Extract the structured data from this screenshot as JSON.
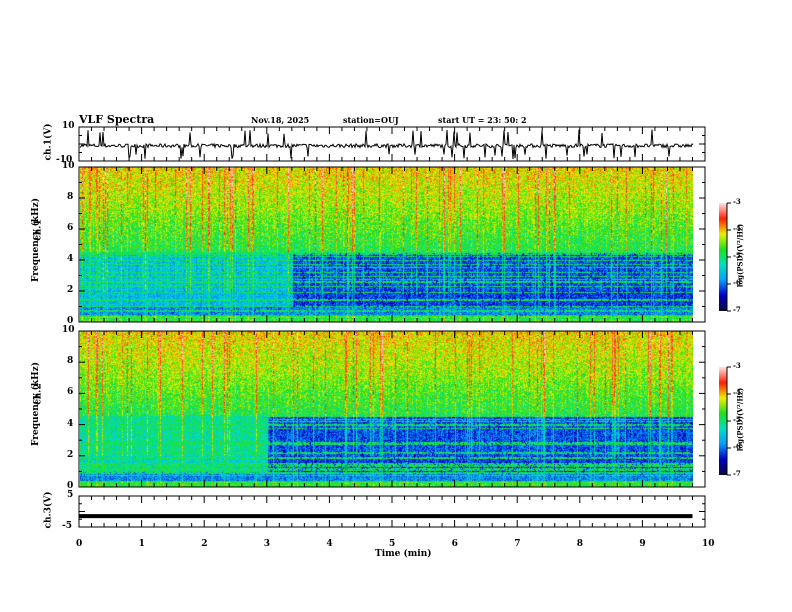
{
  "header": {
    "title": "VLF Spectra",
    "date": "Nov.18, 2025",
    "station": "station=OUJ",
    "start": "start  UT =   23: 50: 2"
  },
  "chart_data": [
    {
      "type": "line",
      "ylabel": "ch.1(V)",
      "ylim": [
        -10,
        10
      ],
      "yticks": [
        "10",
        "-10"
      ],
      "xlim": [
        0,
        10
      ],
      "description_values": {
        "baseline": -1,
        "noise_amplitude": 1.5,
        "spike_range": [
          -9,
          9
        ]
      }
    },
    {
      "type": "heatmap",
      "ylabel": "ch.1\nFrequency (kHz)",
      "ylabel_lines": [
        "ch.1",
        "Frequency  (kHz)"
      ],
      "ylim": [
        0,
        10
      ],
      "yticks": [
        "0",
        "2",
        "4",
        "6",
        "8",
        "10"
      ],
      "xlim": [
        0,
        10
      ],
      "data_end_min": 9.8,
      "zlim": [
        -7,
        -3
      ],
      "colorbar_label": "log(PSD)(V²/Hz)",
      "colorbar_ticks": [
        "-3",
        "-4",
        "-5",
        "-6",
        "-7"
      ],
      "colorscale": [
        "#0a0a3c",
        "#0000c8",
        "#00a0ff",
        "#00e0c0",
        "#20e020",
        "#f0f000",
        "#ff2000",
        "#ffe0e0"
      ]
    },
    {
      "type": "heatmap",
      "ylabel_lines": [
        "ch.2",
        "Frequency  (kHz)"
      ],
      "ylim": [
        0,
        10
      ],
      "yticks": [
        "0",
        "2",
        "4",
        "6",
        "8",
        "10"
      ],
      "xlim": [
        0,
        10
      ],
      "data_end_min": 9.8,
      "zlim": [
        -7,
        -3
      ],
      "colorbar_label": "log(PSD)(V²/Hz)",
      "colorbar_ticks": [
        "-3",
        "-4",
        "-5",
        "-6",
        "-7"
      ]
    },
    {
      "type": "line",
      "ylabel": "ch.3(V)",
      "ylim": [
        -5,
        5
      ],
      "yticks": [
        "5",
        "-5"
      ],
      "x": [
        0,
        9.8
      ],
      "y": [
        -1.5,
        -1.5
      ]
    }
  ],
  "xaxis": {
    "label": "Time  (min)",
    "ticks": [
      "0",
      "1",
      "2",
      "3",
      "4",
      "5",
      "6",
      "7",
      "8",
      "9",
      "10"
    ]
  }
}
